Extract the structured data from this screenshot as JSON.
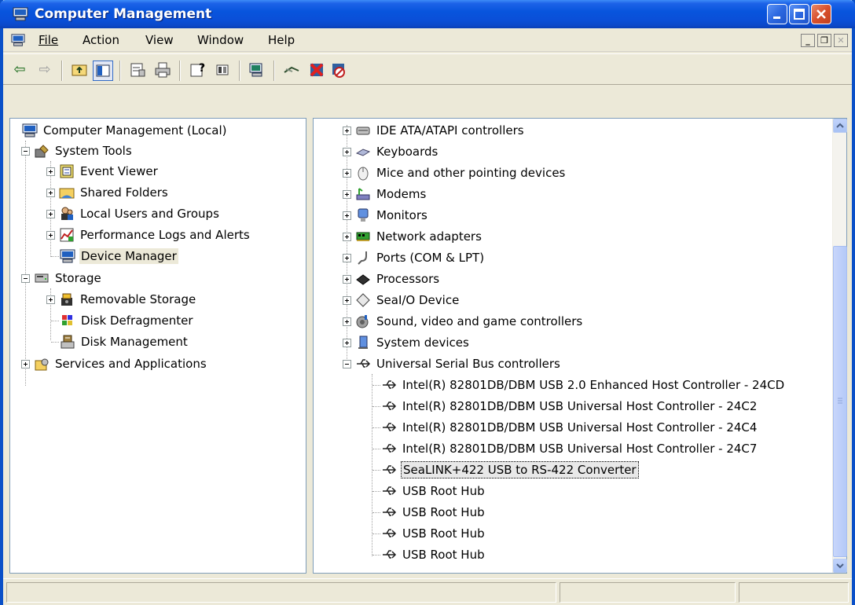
{
  "window": {
    "title": "Computer Management",
    "buttons": [
      "minimize",
      "maximize",
      "close"
    ]
  },
  "menubar": {
    "items": [
      {
        "label": "File",
        "accel": "F"
      },
      {
        "label": "Action",
        "accel": "A"
      },
      {
        "label": "View",
        "accel": "V"
      },
      {
        "label": "Window",
        "accel": "W"
      },
      {
        "label": "Help",
        "accel": "H"
      }
    ]
  },
  "toolbar": {
    "icons": [
      "back-arrow-icon",
      "forward-arrow-icon",
      "up-folder-icon",
      "show-hide-tree-icon",
      "properties-icon",
      "print-icon",
      "help-icon",
      "console-icon",
      "computer-icon",
      "disconnect-icon",
      "uninstall-icon",
      "disable-icon"
    ]
  },
  "left_tree": {
    "root": "Computer Management (Local)",
    "system_tools": "System Tools",
    "event_viewer": "Event Viewer",
    "shared_folders": "Shared Folders",
    "local_users": "Local Users and Groups",
    "perf_logs": "Performance Logs and Alerts",
    "device_manager": "Device Manager",
    "storage": "Storage",
    "removable_storage": "Removable Storage",
    "disk_defrag": "Disk Defragmenter",
    "disk_mgmt": "Disk Management",
    "services_apps": "Services and Applications"
  },
  "right_tree": {
    "categories": [
      "IDE ATA/ATAPI controllers",
      "Keyboards",
      "Mice and other pointing devices",
      "Modems",
      "Monitors",
      "Network adapters",
      "Ports (COM & LPT)",
      "Processors",
      "SeaI/O Device",
      "Sound, video and game controllers",
      "System devices",
      "Universal Serial Bus controllers"
    ],
    "usb_devices": [
      "Intel(R) 82801DB/DBM USB 2.0 Enhanced Host Controller - 24CD",
      "Intel(R) 82801DB/DBM USB Universal Host Controller - 24C2",
      "Intel(R) 82801DB/DBM USB Universal Host Controller - 24C4",
      "Intel(R) 82801DB/DBM USB Universal Host Controller - 24C7",
      "SeaLINK+422 USB to RS-422 Converter",
      "USB Root Hub",
      "USB Root Hub",
      "USB Root Hub",
      "USB Root Hub"
    ],
    "selected_device": "SeaLINK+422 USB to RS-422 Converter"
  },
  "colors": {
    "titlebar": "#0a4fd8",
    "window_bg": "#ece9d8",
    "pane_border": "#7f9db9"
  }
}
